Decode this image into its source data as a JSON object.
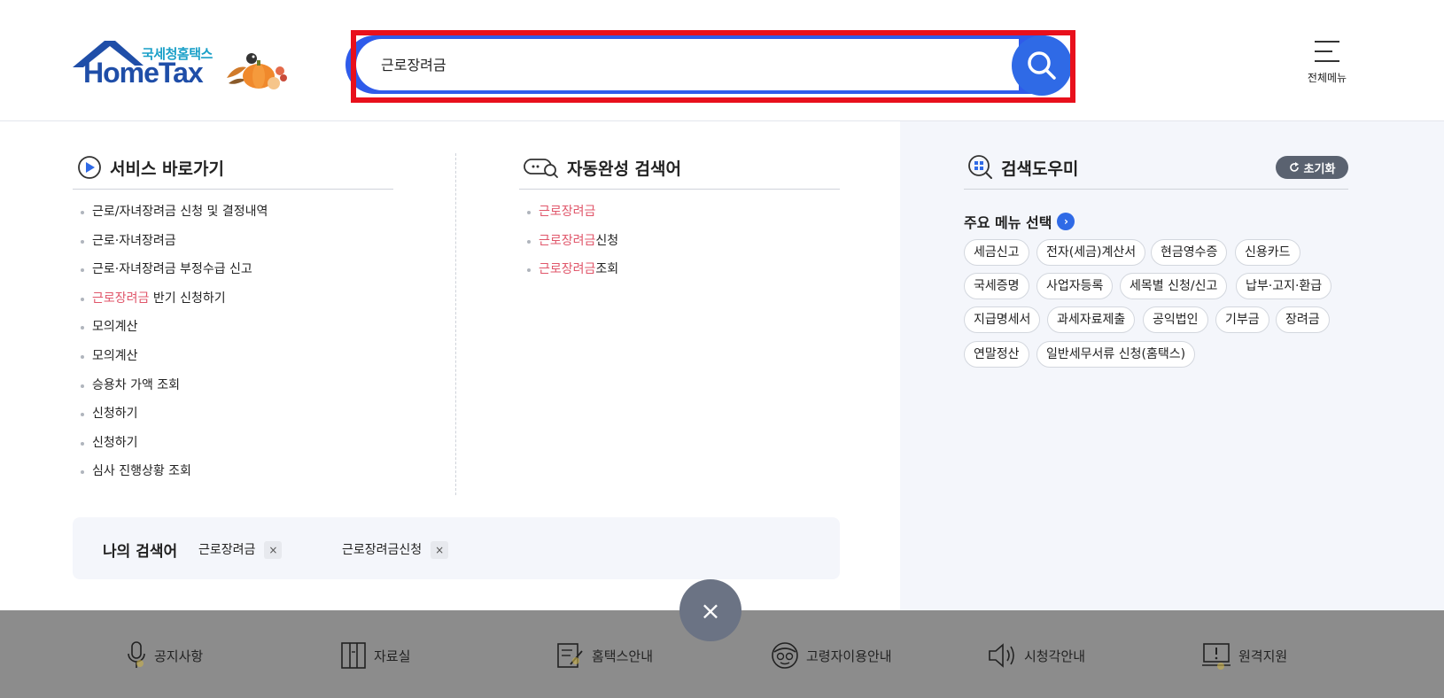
{
  "header": {
    "logo_sub": "국세청홈택스",
    "logo_main": "HomeTax",
    "search_value": "근로장려금",
    "all_menu_label": "전체메뉴"
  },
  "service_shortcuts": {
    "title": "서비스 바로가기",
    "items": [
      {
        "hl": "",
        "text": "근로/자녀장려금 신청 및 결정내역"
      },
      {
        "hl": "",
        "text": "근로·자녀장려금"
      },
      {
        "hl": "",
        "text": "근로·자녀장려금 부정수급 신고"
      },
      {
        "hl": "근로장려금",
        "text": " 반기 신청하기"
      },
      {
        "hl": "",
        "text": "모의계산"
      },
      {
        "hl": "",
        "text": "모의계산"
      },
      {
        "hl": "",
        "text": "승용차 가액 조회"
      },
      {
        "hl": "",
        "text": "신청하기"
      },
      {
        "hl": "",
        "text": "신청하기"
      },
      {
        "hl": "",
        "text": "심사 진행상황 조회"
      }
    ]
  },
  "autocomplete": {
    "title": "자동완성 검색어",
    "items": [
      {
        "hl": "근로장려금",
        "text": ""
      },
      {
        "hl": "근로장려금",
        "text": "신청"
      },
      {
        "hl": "근로장려금",
        "text": "조회"
      }
    ]
  },
  "my_search": {
    "label": "나의 검색어",
    "terms": [
      "근로장려금",
      "근로장려금신청"
    ],
    "remove_glyph": "×"
  },
  "helper": {
    "title": "검색도우미",
    "reset_label": "초기화",
    "main_menu_label": "주요 메뉴 선택",
    "tags": [
      "세금신고",
      "전자(세금)계산서",
      "현금영수증",
      "신용카드",
      "국세증명",
      "사업자등록",
      "세목별 신청/신고",
      "납부·고지·환급",
      "지급명세서",
      "과세자료제출",
      "공익법인",
      "기부금",
      "장려금",
      "연말정산",
      "일반세무서류 신청(홈택스)"
    ]
  },
  "close_glyph": "×",
  "footer": {
    "items": [
      "공지사항",
      "자료실",
      "홈택스안내",
      "고령자이용안내",
      "시청각안내",
      "원격지원"
    ]
  },
  "colors": {
    "accent": "#2f6ae6",
    "highlight_text": "#e0566a",
    "annotation_border": "#e8101c",
    "footer_bg": "#8c8c8c"
  }
}
